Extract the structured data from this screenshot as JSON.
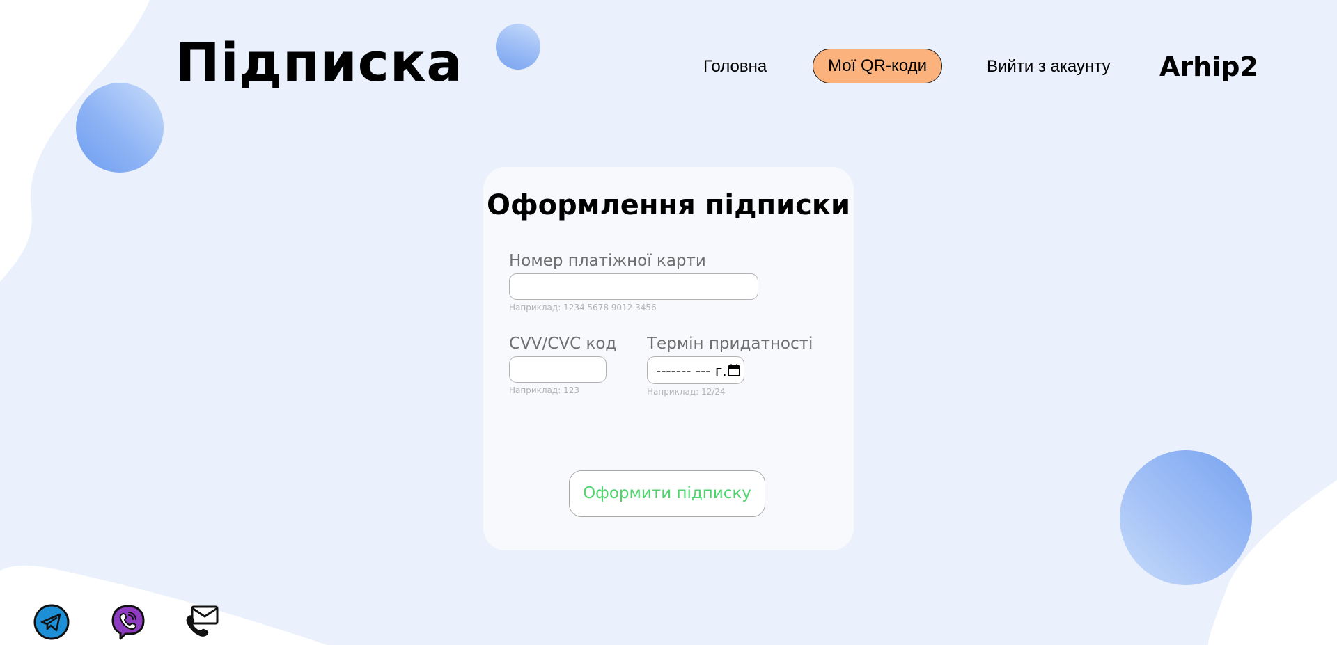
{
  "header": {
    "page_title": "Підписка",
    "nav": {
      "home_label": "Головна",
      "qr_label": "Мої QR-коди",
      "logout_label": "Вийти з акаунту"
    },
    "user_name": "Arhip2"
  },
  "form": {
    "title": "Оформлення підписки",
    "card_number": {
      "label": "Номер платіжної карти",
      "value": "",
      "hint": "Наприклад: 1234 5678 9012 3456"
    },
    "cvv": {
      "label": "CVV/CVC код",
      "value": "",
      "hint": "Наприклад: 123"
    },
    "expiry": {
      "label": "Термін придатності",
      "display_value": "------- --- г.",
      "hint": "Наприклад: 12/24"
    },
    "submit_label": "Оформити підписку"
  },
  "social": {
    "icons": [
      "telegram-icon",
      "viber-icon",
      "mail-phone-icon"
    ]
  },
  "colors": {
    "background_blob": "#eaf1fc",
    "card_bg": "#f7f9fd",
    "active_nav_bg": "#fbb27d",
    "submit_text": "#4ed46c",
    "bubble_blue": "#7aa6f0"
  }
}
